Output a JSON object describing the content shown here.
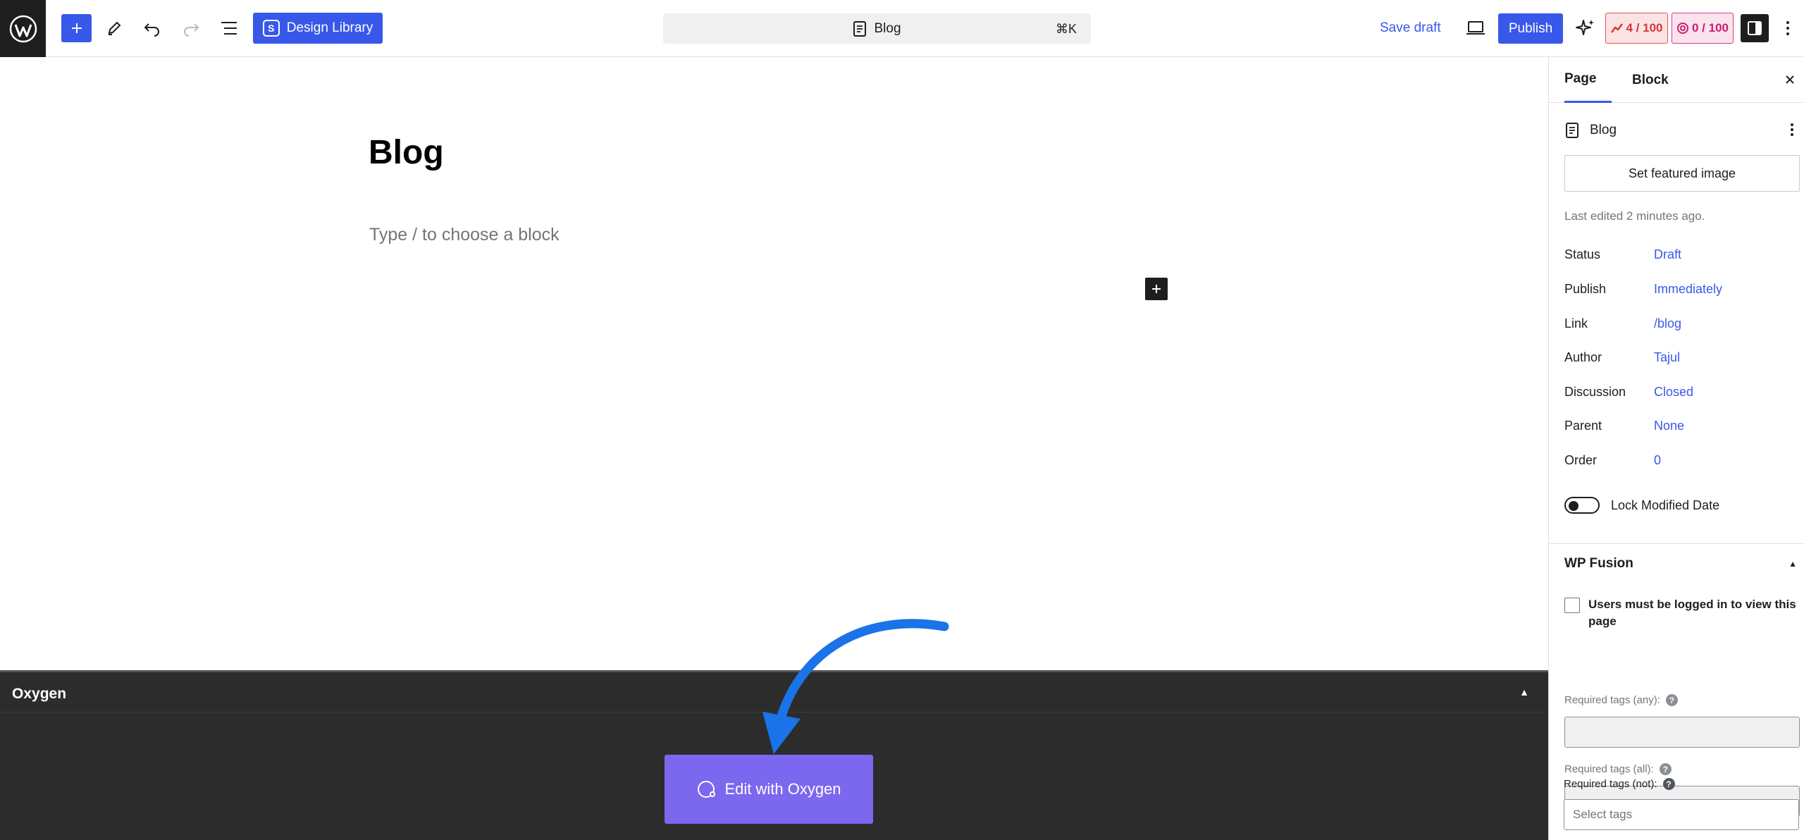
{
  "toolbar": {
    "design_library_label": "Design Library",
    "design_library_badge": "S",
    "command_title": "Blog",
    "command_shortcut": "⌘K",
    "save_draft_label": "Save draft",
    "publish_label": "Publish",
    "score_a": "4 / 100",
    "score_b": "0 / 100"
  },
  "editor": {
    "title": "Blog",
    "placeholder": "Type / to choose a block"
  },
  "oxygen": {
    "title": "Oxygen",
    "button_label": "Edit with Oxygen"
  },
  "sidebar": {
    "tabs": {
      "page": "Page",
      "block": "Block"
    },
    "document_title": "Blog",
    "featured_image_label": "Set featured image",
    "last_edited": "Last edited 2 minutes ago.",
    "meta": [
      {
        "label": "Status",
        "value": "Draft"
      },
      {
        "label": "Publish",
        "value": "Immediately"
      },
      {
        "label": "Link",
        "value": "/blog"
      },
      {
        "label": "Author",
        "value": "Tajul"
      },
      {
        "label": "Discussion",
        "value": "Closed"
      },
      {
        "label": "Parent",
        "value": "None"
      },
      {
        "label": "Order",
        "value": "0"
      }
    ],
    "lock_modified_label": "Lock Modified Date",
    "wp_fusion": {
      "title": "WP Fusion",
      "login_required_label": "Users must be logged in to view this page",
      "tags_any_label": "Required tags (any):",
      "tags_all_label": "Required tags (all):",
      "tags_not_label": "Required tags (not):",
      "select_tags_placeholder": "Select tags",
      "help_glyph": "?"
    }
  },
  "colors": {
    "accent": "#3858e9",
    "oxygen_button": "#7b68ee",
    "oxygen_panel": "#2c2c2c",
    "annotation_arrow": "#1a73e8"
  }
}
